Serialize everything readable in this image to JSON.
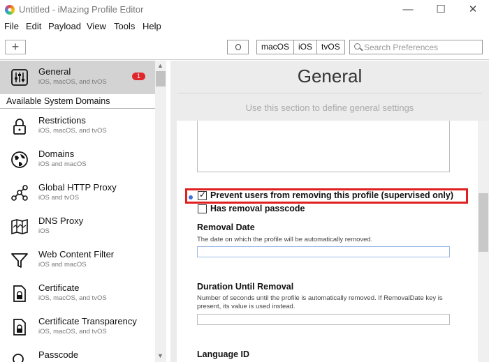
{
  "window": {
    "title": "Untitled - iMazing Profile Editor",
    "controls": {
      "minimize": "—",
      "maximize": "☐",
      "close": "✕"
    }
  },
  "menu": [
    "File",
    "Edit",
    "Payload",
    "View",
    "Tools",
    "Help"
  ],
  "toolbar": {
    "add_label": "+",
    "os_buttons": [
      "macOS",
      "iOS",
      "tvOS"
    ],
    "search_placeholder": "Search Preferences"
  },
  "sidebar": {
    "selected": {
      "title": "General",
      "subtitle": "iOS, macOS, and tvOS",
      "badge": "1",
      "icon": "sliders-icon"
    },
    "section_header": "Available System Domains",
    "items": [
      {
        "title": "Restrictions",
        "subtitle": "iOS, macOS, and tvOS",
        "icon": "lock-icon"
      },
      {
        "title": "Domains",
        "subtitle": "iOS and macOS",
        "icon": "globe-icon"
      },
      {
        "title": "Global HTTP Proxy",
        "subtitle": "iOS and tvOS",
        "icon": "network-icon"
      },
      {
        "title": "DNS Proxy",
        "subtitle": "iOS",
        "icon": "map-icon"
      },
      {
        "title": "Web Content Filter",
        "subtitle": "iOS and macOS",
        "icon": "funnel-icon"
      },
      {
        "title": "Certificate",
        "subtitle": "iOS, macOS, and tvOS",
        "icon": "certificate-icon"
      },
      {
        "title": "Certificate Transparency",
        "subtitle": "iOS, macOS, and tvOS",
        "icon": "certificate-icon"
      },
      {
        "title": "Passcode",
        "subtitle": "",
        "icon": "passcode-icon"
      }
    ]
  },
  "main": {
    "title": "General",
    "subtitle": "Use this section to define general settings",
    "prevent_removal": {
      "label": "Prevent users from removing this profile (supervised only)",
      "checked": true
    },
    "has_passcode": {
      "label": "Has removal passcode",
      "checked": false
    },
    "removal_date": {
      "title": "Removal Date",
      "description": "The date on which the profile will be automatically removed.",
      "value": ""
    },
    "duration": {
      "title": "Duration Until Removal",
      "description": "Number of seconds until the profile is automatically removed. If RemovalDate key is present, its value is used instead.",
      "value": ""
    },
    "language": {
      "title": "Language ID"
    }
  },
  "colors": {
    "highlight": "#e02020",
    "badge": "#e0262a",
    "bullet": "#3a6fd8",
    "sidebar_selected": "#d3d3d3"
  }
}
